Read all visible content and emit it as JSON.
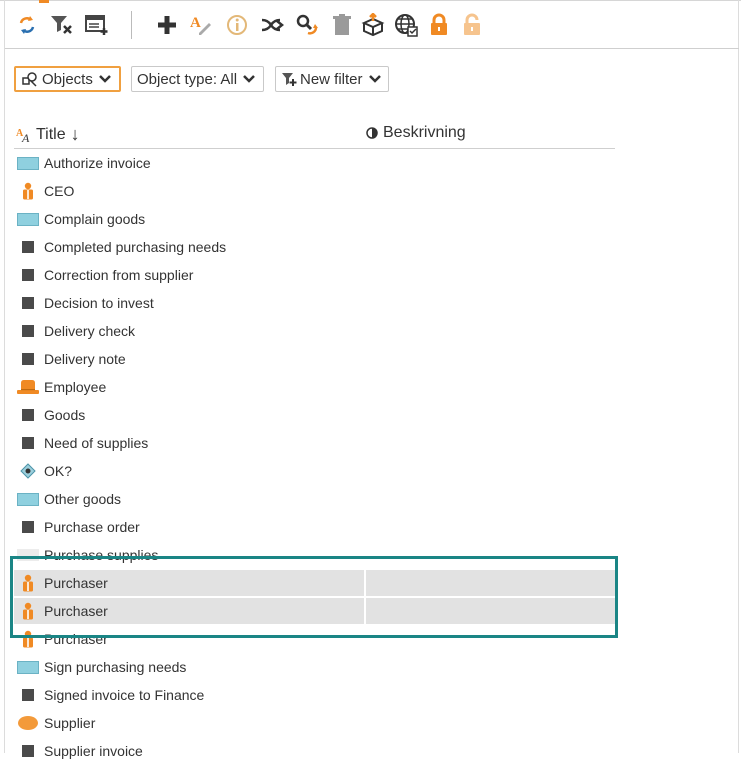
{
  "colors": {
    "accent": "#f08a24",
    "highlight_border": "#1a8585",
    "selected_row": "#e2e2e2"
  },
  "toolbar": {
    "items": [
      {
        "name": "refresh-icon"
      },
      {
        "name": "clear-filter-icon"
      },
      {
        "name": "new-table-icon"
      },
      {
        "name": "add-icon"
      },
      {
        "name": "rename-icon"
      },
      {
        "name": "info-icon"
      },
      {
        "name": "navigate-icon"
      },
      {
        "name": "replace-icon"
      },
      {
        "name": "delete-icon"
      },
      {
        "name": "export-icon"
      },
      {
        "name": "publish-icon"
      },
      {
        "name": "lock-icon"
      },
      {
        "name": "unlock-icon"
      }
    ]
  },
  "filters": {
    "objects_label": "Objects",
    "object_type_label": "Object type: All",
    "new_filter_label": "New filter"
  },
  "table": {
    "columns": {
      "title": "Title",
      "sort_arrow": "↓",
      "description": "Beskrivning"
    },
    "rows": [
      {
        "label": "Authorize invoice",
        "icon": "rectangle"
      },
      {
        "label": "CEO",
        "icon": "person"
      },
      {
        "label": "Complain goods",
        "icon": "rectangle"
      },
      {
        "label": "Completed purchasing needs",
        "icon": "square"
      },
      {
        "label": "Correction from supplier",
        "icon": "square"
      },
      {
        "label": "Decision to invest",
        "icon": "square"
      },
      {
        "label": "Delivery check",
        "icon": "square"
      },
      {
        "label": "Delivery note",
        "icon": "square"
      },
      {
        "label": "Employee",
        "icon": "hat"
      },
      {
        "label": "Goods",
        "icon": "square"
      },
      {
        "label": "Need of supplies",
        "icon": "square"
      },
      {
        "label": "OK?",
        "icon": "diamond"
      },
      {
        "label": "Other goods",
        "icon": "rectangle"
      },
      {
        "label": "Purchase order",
        "icon": "square"
      },
      {
        "label": "Purchase supplies",
        "icon": "ghost"
      },
      {
        "label": "Purchaser",
        "icon": "person",
        "selected": true
      },
      {
        "label": "Purchaser",
        "icon": "person",
        "selected": true
      },
      {
        "label": "Purchaser",
        "icon": "person"
      },
      {
        "label": "Sign purchasing needs",
        "icon": "rectangle"
      },
      {
        "label": "Signed invoice to Finance",
        "icon": "square"
      },
      {
        "label": "Supplier",
        "icon": "ellipse"
      },
      {
        "label": "Supplier invoice",
        "icon": "square"
      }
    ]
  }
}
